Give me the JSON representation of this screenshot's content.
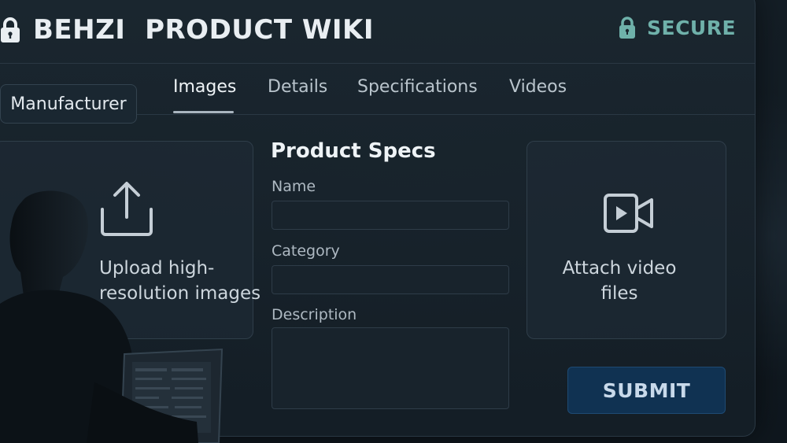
{
  "header": {
    "brand_title": "BEHZI  PRODUCT WIKI",
    "lock_icon": "lock-icon",
    "secure_label": "SECURE",
    "secure_icon": "lock-icon"
  },
  "tabs": [
    {
      "label": "Manufacturer",
      "state": "chip"
    },
    {
      "label": "Images",
      "state": "active"
    },
    {
      "label": "Details",
      "state": "inactive"
    },
    {
      "label": "Specifications",
      "state": "inactive"
    },
    {
      "label": "Videos",
      "state": "inactive"
    }
  ],
  "upload_card": {
    "icon": "upload-icon",
    "text_line1": "Upload high-",
    "text_line2": "resolution images"
  },
  "form": {
    "title": "Product Specs",
    "fields": [
      {
        "label": "Name",
        "value": ""
      },
      {
        "label": "Category",
        "value": ""
      },
      {
        "label": "Description",
        "value": ""
      }
    ]
  },
  "video_card": {
    "icon": "video-camera-icon",
    "text_line1": "Attach video",
    "text_line2": "files"
  },
  "submit": {
    "label": "SUBMIT"
  },
  "colors": {
    "background": "#0c1319",
    "secure_accent": "#6fb1aa",
    "submit_bg": "#103252"
  }
}
